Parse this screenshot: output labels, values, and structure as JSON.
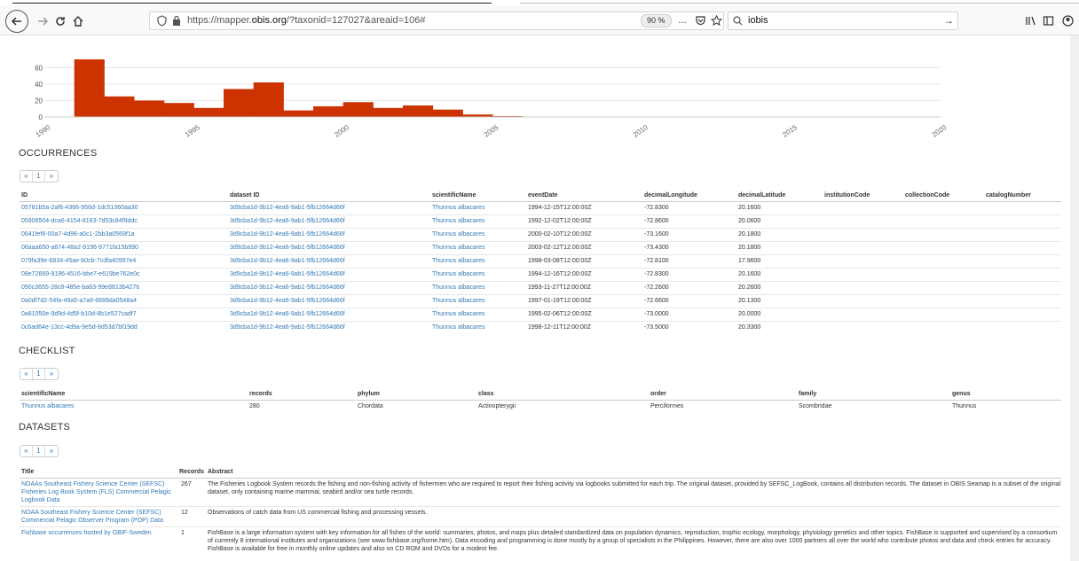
{
  "browser": {
    "url_prefix": "https://mapper.",
    "url_domain": "obis.org",
    "url_suffix": "/?taxonid=127027&areaid=106#",
    "zoom": "90 %",
    "search_value": "iobis",
    "more_icon": "...",
    "arrow_icon": "→"
  },
  "chart_data": {
    "type": "bar",
    "title": "",
    "xlabel": "",
    "ylabel": "",
    "bar_color": "#cc3300",
    "xlim": [
      1990,
      2020
    ],
    "ylim": [
      0,
      70
    ],
    "yticks": [
      "60",
      "40",
      "20",
      "0"
    ],
    "xticks": [
      "1990",
      "1995",
      "2000",
      "2005",
      "2010",
      "2015",
      "2020"
    ],
    "x": [
      1991,
      1992,
      1993,
      1994,
      1995,
      1996,
      1997,
      1998,
      1999,
      2000,
      2001,
      2002,
      2003,
      2004,
      2005
    ],
    "values": [
      70,
      25,
      20,
      17,
      11,
      34,
      42,
      8,
      13,
      18,
      11,
      14,
      9,
      3,
      1
    ]
  },
  "occurrences": {
    "title": "OCCURRENCES",
    "pager": [
      "«",
      "1",
      "»"
    ],
    "columns": [
      "ID",
      "dataset ID",
      "scientificName",
      "eventDate",
      "decimalLongitude",
      "decimalLatitude",
      "institutionCode",
      "collectionCode",
      "catalogNumber"
    ],
    "rows": [
      [
        "05781b5a-2af6-4366-956d-1dc51360aa30",
        "3d9cba1d-9b12-4ea6-9ab1-5fb12664d66f",
        "Thunnus albacares",
        "1994-12-15T12:00:00Z",
        "-72.8300",
        "20.1600",
        "",
        "",
        ""
      ],
      [
        "05906504-dca6-4154-8163-7d53c84f9ddc",
        "3d9cba1d-9b12-4ea6-9ab1-5fb12664d66f",
        "Thunnus albacares",
        "1992-12-02T12:00:00Z",
        "-72.8600",
        "20.0600",
        "",
        "",
        ""
      ],
      [
        "0641fef6-00a7-4d96-a0c1-2bb3a0569f1a",
        "3d9cba1d-9b12-4ea6-9ab1-5fb12664d66f",
        "Thunnus albacares",
        "2000-02-10T12:00:00Z",
        "-73.1600",
        "20.1800",
        "",
        "",
        ""
      ],
      [
        "06aaa650-a874-48a2-9196-9771fa15b990",
        "3d9cba1d-9b12-4ea6-9ab1-5fb12664d66f",
        "Thunnus albacares",
        "2003-02-12T12:00:00Z",
        "-73.4300",
        "20.1800",
        "",
        "",
        ""
      ],
      [
        "079fa39e-6834-45ae-b0cb-7cdfa40997e4",
        "3d9cba1d-9b12-4ea6-9ab1-5fb12664d66f",
        "Thunnus albacares",
        "1998-03-08T12:00:00Z",
        "-72.8100",
        "17.9600",
        "",
        "",
        ""
      ],
      [
        "08e72669-9196-4516-bbe7-e619be762e0c",
        "3d9cba1d-9b12-4ea6-9ab1-5fb12664d66f",
        "Thunnus albacares",
        "1994-12-16T12:00:00Z",
        "-72.8300",
        "20.1600",
        "",
        "",
        ""
      ],
      [
        "090c3655-28c8-485e-ba63-99e8813b4276",
        "3d9cba1d-9b12-4ea6-9ab1-5fb12664d66f",
        "Thunnus albacares",
        "1993-11-27T12:00:00Z",
        "-72.2600",
        "20.2600",
        "",
        "",
        ""
      ],
      [
        "0a0df7d2-54fa-49a5-a7a8-6889da0548a4",
        "3d9cba1d-9b12-4ea6-9ab1-5fb12664d66f",
        "Thunnus albacares",
        "1997-01-19T12:00:00Z",
        "-72.6600",
        "20.1300",
        "",
        "",
        ""
      ],
      [
        "0a81050e-9d9d-4d5f-b10d-8b1e527cadf7",
        "3d9cba1d-9b12-4ea6-9ab1-5fb12664d66f",
        "Thunnus albacares",
        "1995-02-06T12:00:00Z",
        "-73.0000",
        "20.0000",
        "",
        "",
        ""
      ],
      [
        "0c6ad64e-13cc-4d9a-9e5d-8d53d7bf19dd",
        "3d9cba1d-9b12-4ea6-9ab1-5fb12664d66f",
        "Thunnus albacares",
        "1998-12-11T12:00:00Z",
        "-73.5000",
        "20.3300",
        "",
        "",
        ""
      ]
    ]
  },
  "checklist": {
    "title": "CHECKLIST",
    "pager": [
      "«",
      "1",
      "»"
    ],
    "columns": [
      "scientificName",
      "records",
      "phylum",
      "class",
      "order",
      "family",
      "genus"
    ],
    "rows": [
      [
        "Thunnus albacares",
        "280",
        "Chordata",
        "Actinopterygii",
        "Perciformes",
        "Scombridae",
        "Thunnus"
      ]
    ]
  },
  "datasets": {
    "title": "DATASETS",
    "pager": [
      "«",
      "1",
      "»"
    ],
    "columns": [
      "Title",
      "Records",
      "Abstract"
    ],
    "rows": [
      [
        "NOAAs Southeast Fishery Science Center (SEFSC) Fisheries Log Book System (FLS) Commercial Pelagic Logbook Data",
        "267",
        "The Fisheries Logbook System records the fishing and non-fishing activity of fishermen who are required to report their fishing activity via logbooks submitted for each trip. The original dataset, provided by SEFSC_LogBook, contains all distribution records. The dataset in OBIS Seamap is a subset of the original dataset, only containing marine mammal, seabird and/or sea turtle records."
      ],
      [
        "NOAA Southeast Fishery Science Center (SEFSC) Commercial Pelagic Observer Program (POP) Data",
        "12",
        "Observations of catch data from US commercial fishing and processing vessels."
      ],
      [
        "Fishbase occurrences hosted by GBIF-Sweden",
        "1",
        "FishBase is a large information system with key information for all fishes of the world: summaries, photos, and maps plus detailed standardized data on population dynamics, reproduction, trophic ecology, morphology, physiology genetics and other topics. FishBase is supported and supervised by a consortium of currently 8 international institutes and organizations (see www.fishbase.org/home.htm). Data encoding and programming is done mostly by a group of specialists in the Philippines. However, there are also over 1000 partners all over the world who contribute photos and data and check entries for accuracy. FishBase is available for free in monthly online updates and also on CD ROM and DVDs for a modest fee."
      ]
    ]
  }
}
